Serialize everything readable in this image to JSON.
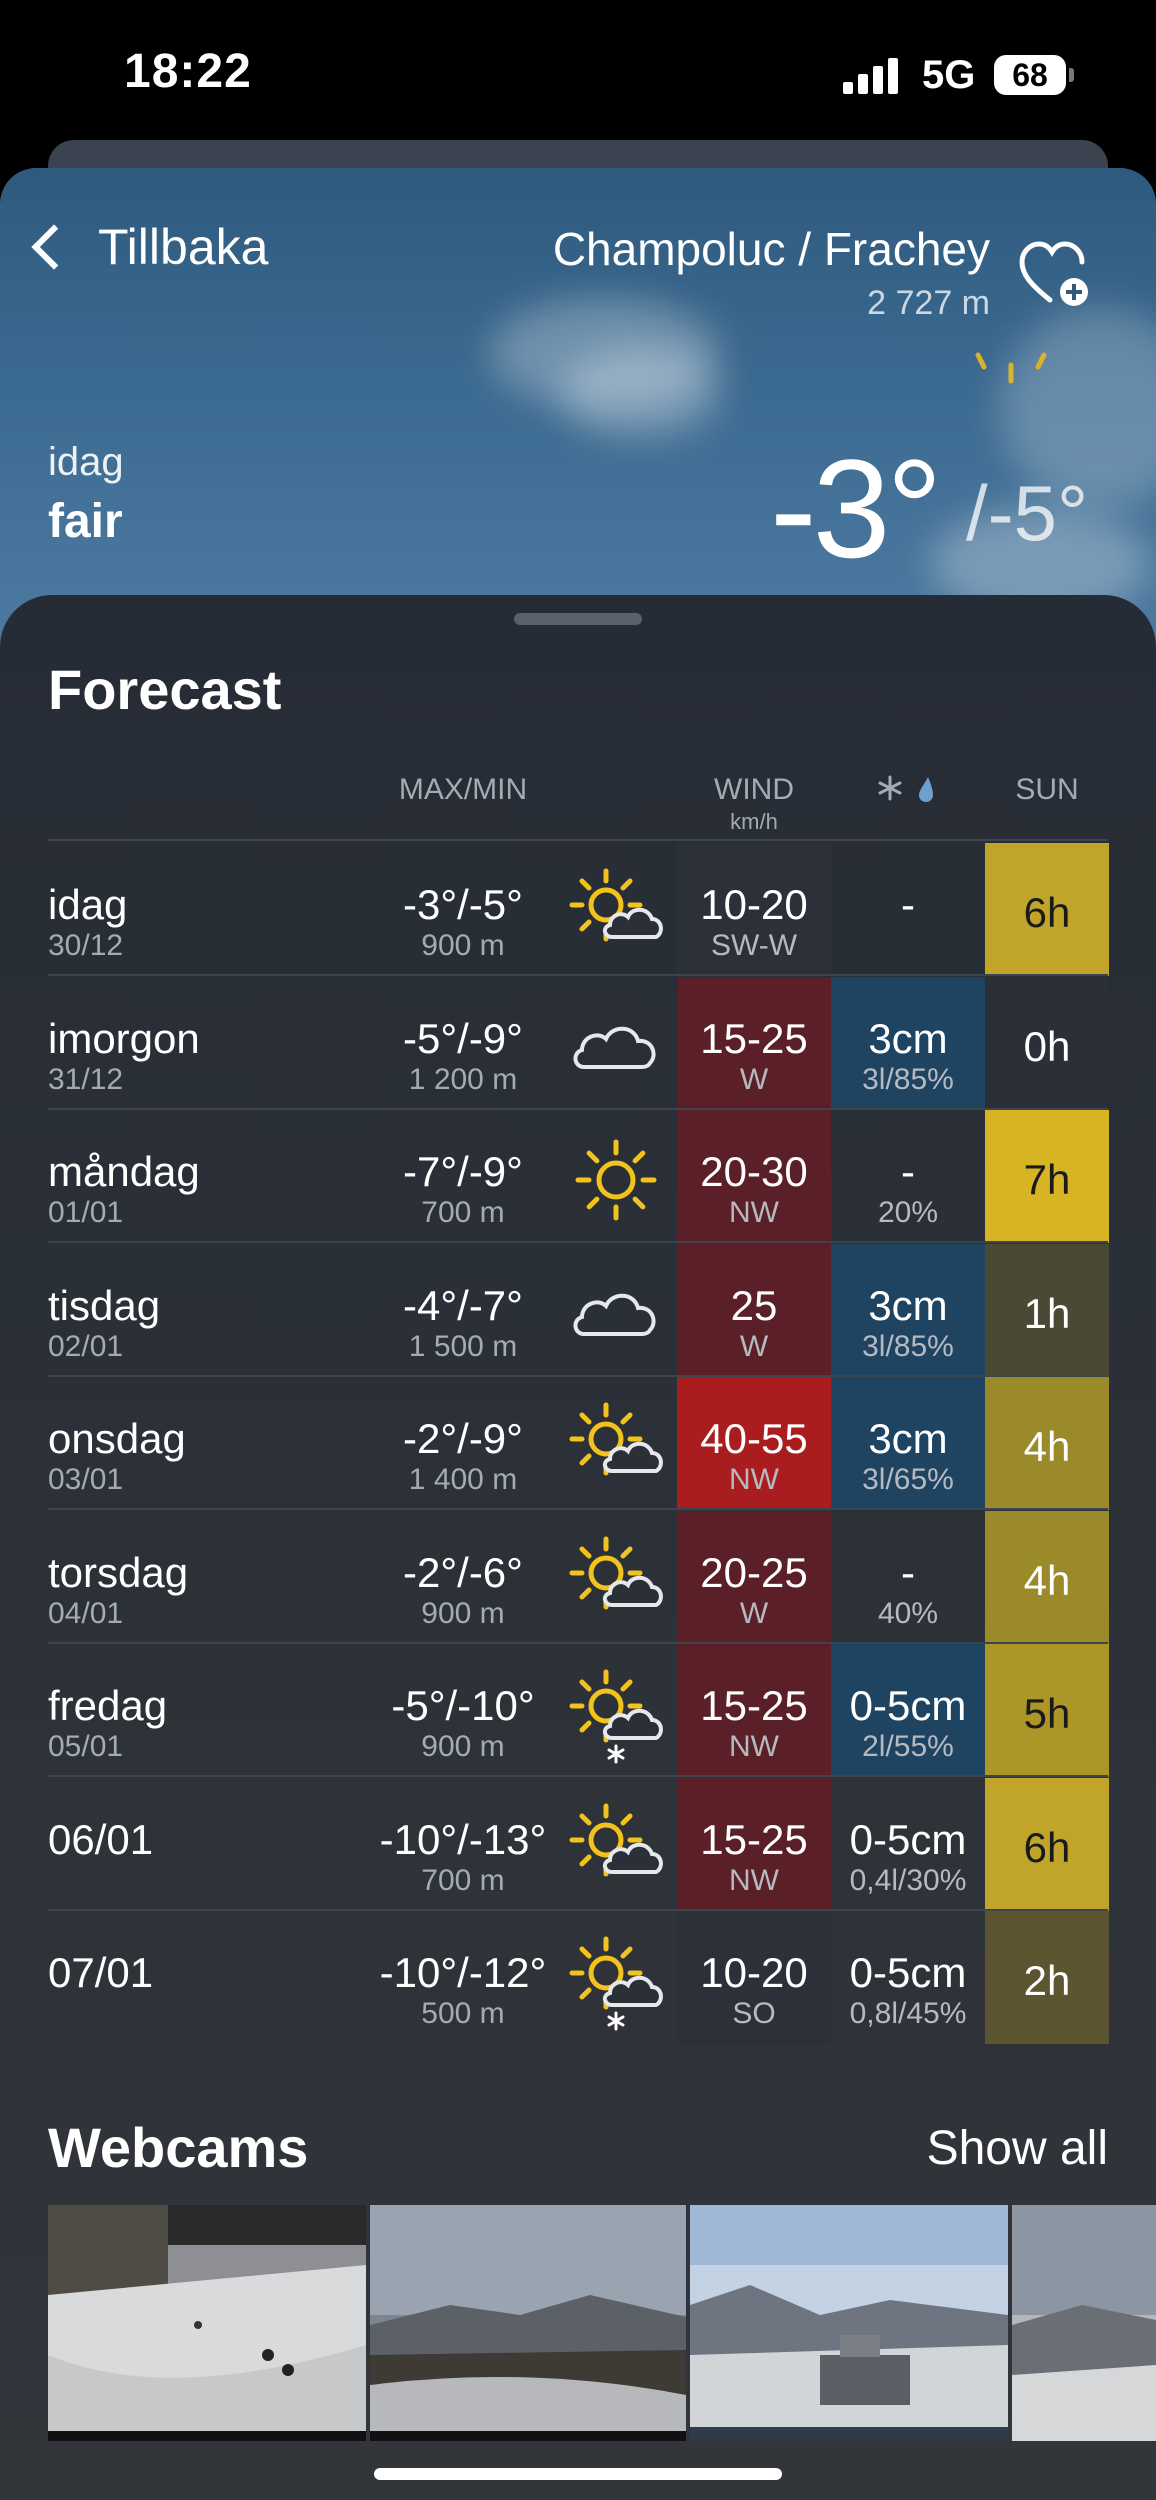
{
  "status": {
    "time": "18:22",
    "network": "5G",
    "battery": "68"
  },
  "header": {
    "back_label": "Tillbaka",
    "location": "Champoluc / Frachey",
    "altitude": "2 727 m",
    "today_label": "idag",
    "condition": "fair",
    "temp_now": "-3°",
    "temp_min": "/-5°"
  },
  "forecast": {
    "title": "Forecast",
    "columns": {
      "maxmin": "MAX/MIN",
      "wind": "WIND",
      "wind_unit": "km/h",
      "sun": "SUN"
    },
    "rows": [
      {
        "day": "idag",
        "date": "30/12",
        "temp": "-3°/-5°",
        "alt": "900 m",
        "icon": "sun-cloud-icon",
        "wind": "10-20",
        "dir": "SW-W",
        "snow": "-",
        "snow_sub": "",
        "sun": "6h"
      },
      {
        "day": "imorgon",
        "date": "31/12",
        "temp": "-5°/-9°",
        "alt": "1 200 m",
        "icon": "cloud-icon",
        "wind": "15-25",
        "dir": "W",
        "snow": "3cm",
        "snow_sub": "3l/85%",
        "sun": "0h"
      },
      {
        "day": "måndag",
        "date": "01/01",
        "temp": "-7°/-9°",
        "alt": "700 m",
        "icon": "sun-icon",
        "wind": "20-30",
        "dir": "NW",
        "snow": "-",
        "snow_sub": "20%",
        "sun": "7h"
      },
      {
        "day": "tisdag",
        "date": "02/01",
        "temp": "-4°/-7°",
        "alt": "1 500 m",
        "icon": "cloud-icon",
        "wind": "25",
        "dir": "W",
        "snow": "3cm",
        "snow_sub": "3l/85%",
        "sun": "1h"
      },
      {
        "day": "onsdag",
        "date": "03/01",
        "temp": "-2°/-9°",
        "alt": "1 400 m",
        "icon": "sun-cloud-icon",
        "wind": "40-55",
        "dir": "NW",
        "snow": "3cm",
        "snow_sub": "3l/65%",
        "sun": "4h"
      },
      {
        "day": "torsdag",
        "date": "04/01",
        "temp": "-2°/-6°",
        "alt": "900 m",
        "icon": "sun-cloud-icon",
        "wind": "20-25",
        "dir": "W",
        "snow": "-",
        "snow_sub": "40%",
        "sun": "4h"
      },
      {
        "day": "fredag",
        "date": "05/01",
        "temp": "-5°/-10°",
        "alt": "900 m",
        "icon": "sun-cloud-snow-icon",
        "wind": "15-25",
        "dir": "NW",
        "snow": "0-5cm",
        "snow_sub": "2l/55%",
        "sun": "5h"
      },
      {
        "day": "06/01",
        "date": "",
        "temp": "-10°/-13°",
        "alt": "700 m",
        "icon": "sun-cloud-icon",
        "wind": "15-25",
        "dir": "NW",
        "snow": "0-5cm",
        "snow_sub": "0,4l/30%",
        "sun": "6h"
      },
      {
        "day": "07/01",
        "date": "",
        "temp": "-10°/-12°",
        "alt": "500 m",
        "icon": "sun-cloud-snow-icon",
        "wind": "10-20",
        "dir": "SO",
        "snow": "0-5cm",
        "snow_sub": "0,8l/45%",
        "sun": "2h"
      }
    ]
  },
  "webcams": {
    "title": "Webcams",
    "show_all": "Show all"
  },
  "colors": {
    "wind_low": "#2c3038",
    "wind_mid": "#5a1f27",
    "wind_high": "#a91d1f",
    "snow_cell": "#1f4462",
    "sun_0": "#2b3038",
    "sun_1": "#4b4835",
    "sun_2": "#5d552f",
    "sun_4": "#9b8a2a",
    "sun_5": "#ab9627",
    "sun_6": "#c1a52b",
    "sun_7": "#d6b423"
  }
}
